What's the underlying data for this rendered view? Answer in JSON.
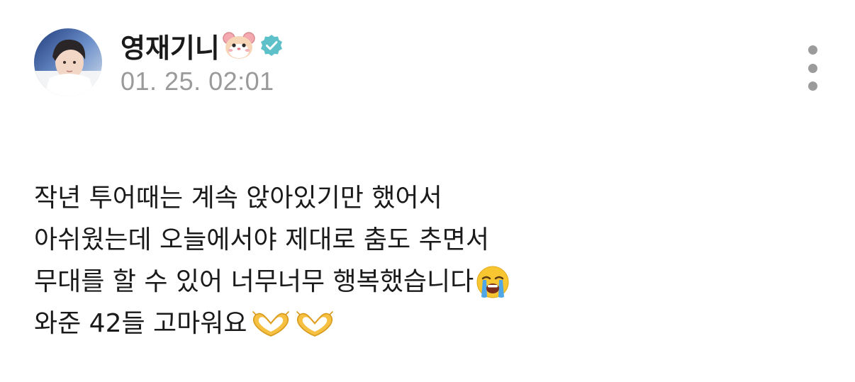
{
  "post": {
    "author": {
      "name": "영재기니",
      "name_emoji": "hamster-face-icon",
      "verified_badge": "verified-check-icon",
      "avatar": "profile-avatar"
    },
    "timestamp": "01. 25. 02:01",
    "more_menu_icon": "vertical-ellipsis-icon",
    "body": {
      "line1": "작년 투어때는 계속 앉아있기만 했어서",
      "line2": "아쉬웠는데 오늘에서야 제대로 춤도 추면서",
      "line3": "무대를 할 수 있어 너무너무 행복했습니다",
      "line3_emoji": "loudly-crying-face-icon",
      "line4": "와준 42들 고마워요",
      "line4_emojis": [
        "heart-hands-icon",
        "heart-hands-icon"
      ]
    }
  },
  "colors": {
    "text": "#1a1a1a",
    "timestamp": "#9a9a9a",
    "verified": "#5ec0c8",
    "menu_dots": "#9b9b9b",
    "background": "#ffffff"
  }
}
